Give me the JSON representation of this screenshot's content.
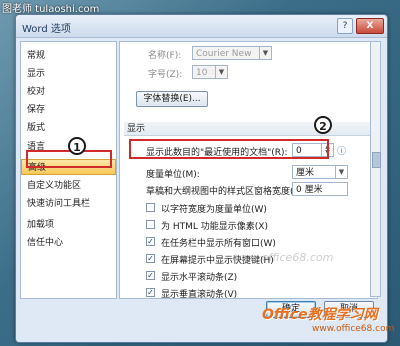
{
  "watermark_top": "图老师 tulaoshi.com",
  "window": {
    "title": "Word 选项",
    "help_label": "?",
    "close_label": "X"
  },
  "nav": {
    "items": [
      {
        "label": "常规"
      },
      {
        "label": "显示"
      },
      {
        "label": "校对"
      },
      {
        "label": "保存"
      },
      {
        "label": "版式"
      },
      {
        "label": "语言"
      },
      {
        "label": "高级",
        "active": true
      },
      {
        "label": "自定义功能区"
      },
      {
        "label": "快速访问工具栏"
      },
      {
        "label": "加载项"
      },
      {
        "label": "信任中心"
      }
    ]
  },
  "content": {
    "font_name_label": "名称(F):",
    "font_name_value": "Courier New",
    "font_size_label": "字号(Z):",
    "font_size_value": "10",
    "font_replace_button": "字体替换(E)...",
    "section_display": "显示",
    "recent_docs_label": "显示此数目的\"最近使用的文档\"(R):",
    "recent_docs_value": "0",
    "unit_label": "度量单位(M):",
    "unit_value": "厘米",
    "style_width_label": "草稿和大纲视图中的样式区窗格宽度(E):",
    "style_width_value": "0 厘米",
    "options": [
      {
        "label": "以字符宽度为度量单位(W)",
        "checked": false
      },
      {
        "label": "为 HTML 功能显示像素(X)",
        "checked": false
      },
      {
        "label": "在任务栏中显示所有窗口(W)",
        "checked": true
      },
      {
        "label": "在屏幕提示中显示快捷键(H)",
        "checked": true
      },
      {
        "label": "显示水平滚动条(Z)",
        "checked": true
      },
      {
        "label": "显示垂直滚动条(V)",
        "checked": true
      }
    ]
  },
  "annotations": {
    "badge_1": "1",
    "badge_2": "2",
    "color": "#d02a2a"
  },
  "footer": {
    "ok_label": "确定",
    "cancel_label": "取消"
  },
  "watermark_bottom": "Office教程学习网",
  "watermark_bottom_url": "www.office68.com",
  "watermark_faint": "www.office68.com"
}
